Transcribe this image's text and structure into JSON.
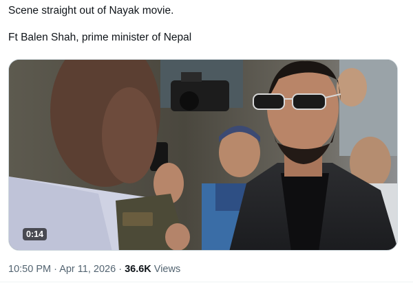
{
  "tweet": {
    "line1": "Scene straight out of Nayak movie.",
    "line2": "Ft Balen Shah, prime minister of Nepal"
  },
  "media": {
    "duration": "0:14",
    "description_icon": "video-play",
    "colors": {
      "frame_bg": "#3a3a34",
      "overlay": "#000000",
      "border": "#cfd9de"
    }
  },
  "meta": {
    "time": "10:50 PM",
    "separator": "·",
    "date": "Apr 11, 2026",
    "views_count": "36.6K",
    "views_label": "Views"
  },
  "colors": {
    "text": "#0f1419",
    "secondary": "#536471",
    "divider": "#eff3f4"
  }
}
